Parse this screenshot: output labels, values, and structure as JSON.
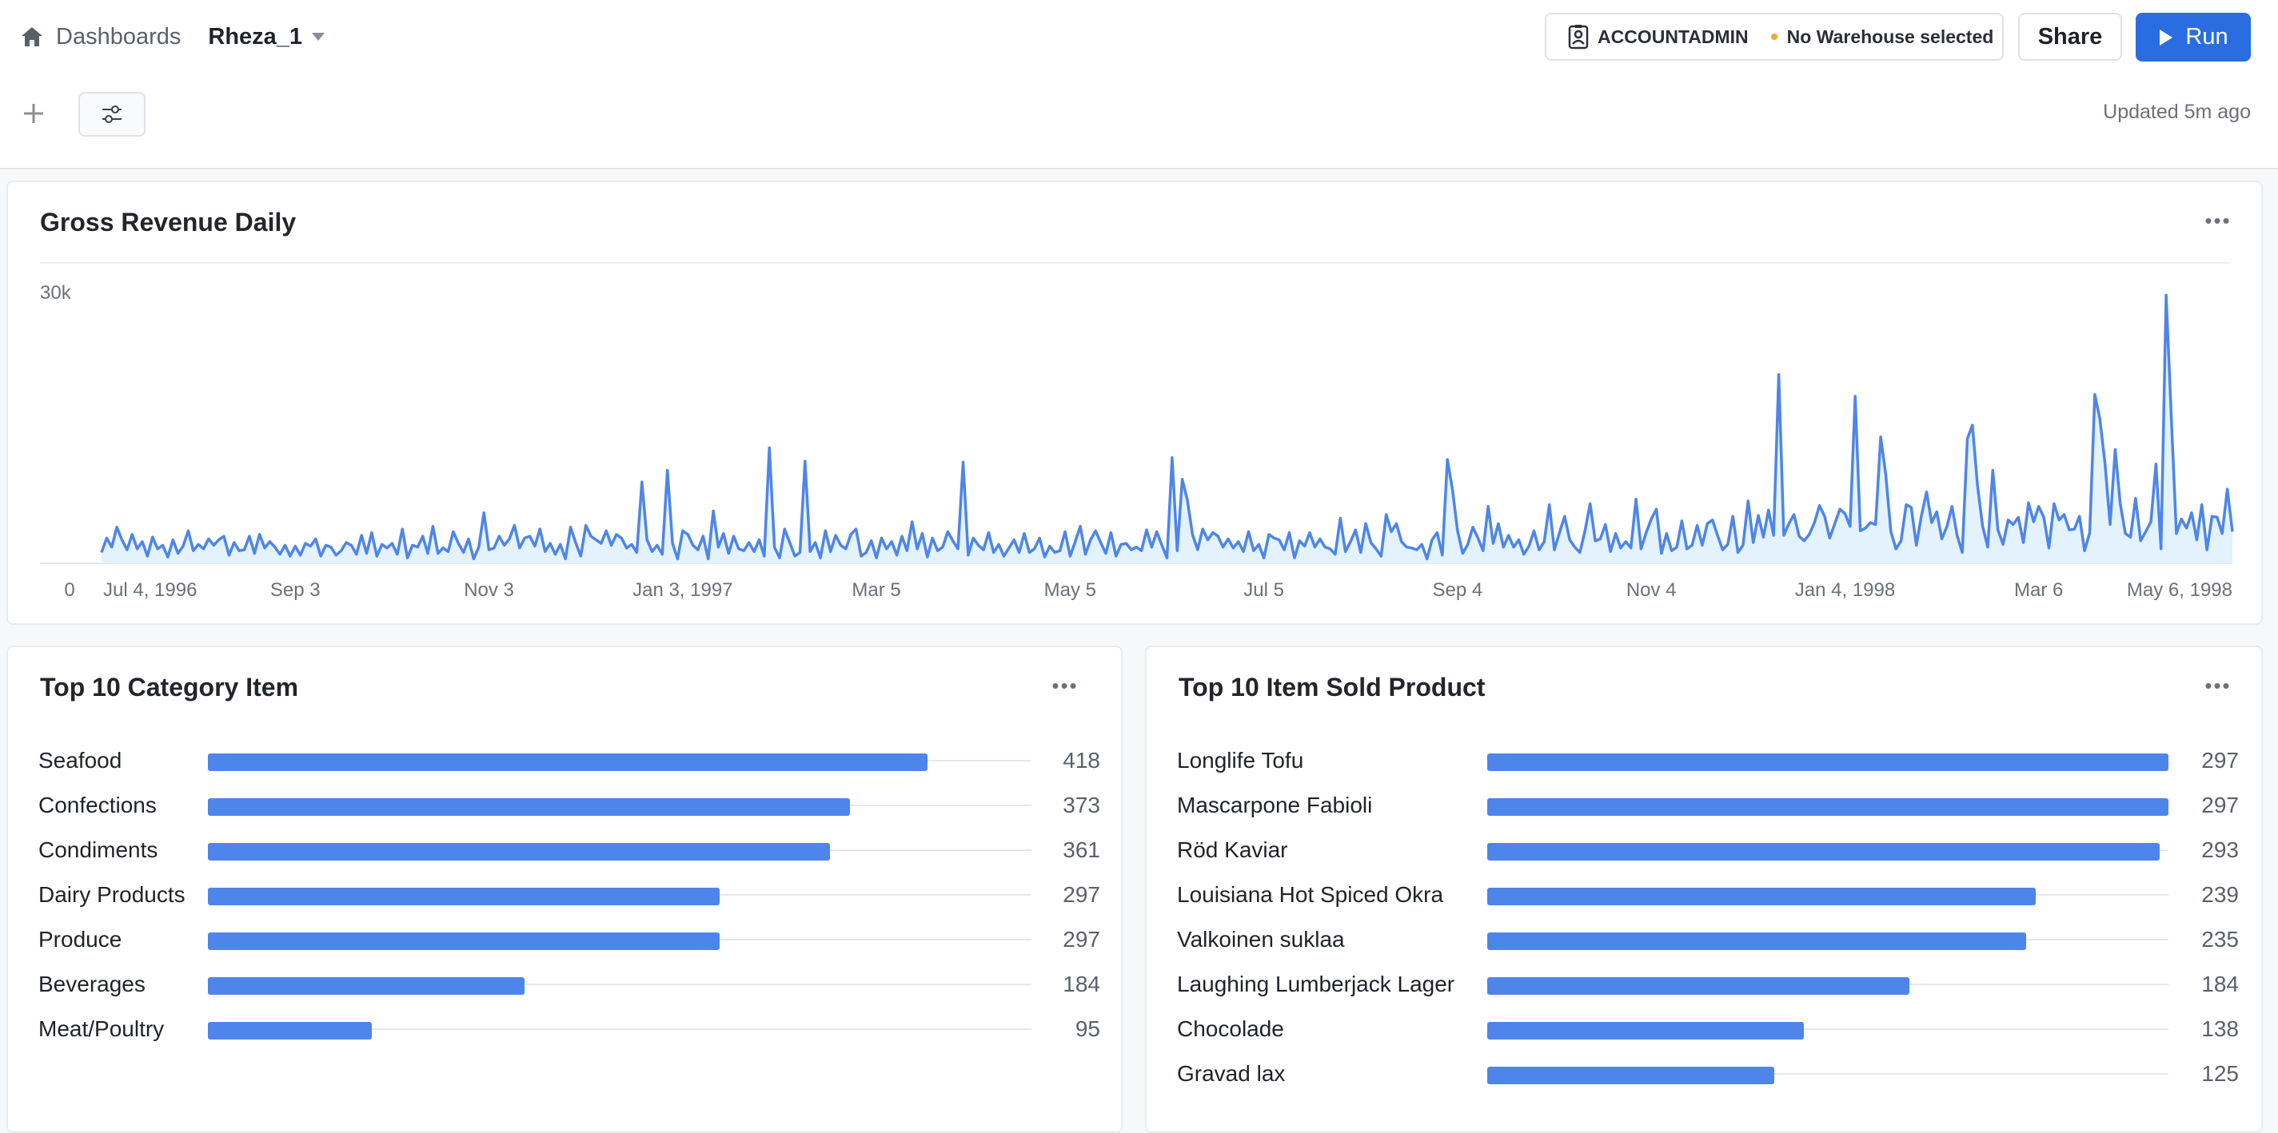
{
  "header": {
    "home_icon": "home-icon",
    "breadcrumb_label": "Dashboards",
    "dashboard_name": "Rheza_1",
    "role": "ACCOUNTADMIN",
    "warehouse": "No Warehouse selected",
    "share_label": "Share",
    "run_label": "Run",
    "updated_text": "Updated 5m ago",
    "colors": {
      "run_button": "#2a6de0",
      "warehouse_dot": "#f0a92c"
    }
  },
  "revenue_card": {
    "title": "Gross Revenue Daily",
    "more_icon": "more-horizontal-icon"
  },
  "category_card": {
    "title": "Top 10 Category Item",
    "more_icon": "more-horizontal-icon"
  },
  "product_card": {
    "title": "Top 10 Item Sold Product",
    "more_icon": "more-horizontal-icon"
  },
  "chart_data": [
    {
      "type": "area",
      "title": "Gross Revenue Daily",
      "xlabel": "",
      "ylabel": "",
      "ylim": [
        0,
        30000
      ],
      "y_ticks": [
        "0",
        "30k"
      ],
      "x_ticks": [
        "Jul 4, 1996",
        "Sep 3",
        "Nov 3",
        "Jan 3, 1997",
        "Mar 5",
        "May 5",
        "Jul 5",
        "Sep 4",
        "Nov 4",
        "Jan 4, 1998",
        "Mar 6",
        "May 6, 1998"
      ],
      "x_range": [
        "1996-07-04",
        "1998-05-06"
      ],
      "color": "#4e85ea",
      "fill": "#e3f2fc",
      "series": [
        {
          "values": [
            1200,
            2800,
            1800,
            4000,
            2600,
            1500,
            3200,
            1600,
            2400,
            800,
            2900,
            1600,
            2000,
            700,
            2600,
            1100,
            1900,
            3600,
            1400,
            2100,
            1600,
            2700,
            2000,
            2600,
            3000,
            900,
            2300,
            1400,
            1500,
            3000,
            1100,
            3200,
            1700,
            2400,
            1800,
            1000,
            2000,
            800,
            1900,
            900,
            2200,
            1900,
            2700,
            800,
            2000,
            1800,
            900,
            1400,
            2300,
            2000,
            1000,
            3100,
            1100,
            3400,
            800,
            2100,
            1700,
            2200,
            1000,
            3800,
            600,
            2000,
            1800,
            3000,
            1100,
            4100,
            1100,
            1700,
            1300,
            3500,
            2200,
            1200,
            2700,
            500,
            1800,
            5600,
            1500,
            1700,
            3000,
            2000,
            2700,
            4200,
            1700,
            2800,
            3000,
            1900,
            3800,
            1300,
            2200,
            1000,
            2100,
            500,
            4000,
            2300,
            800,
            4200,
            3000,
            2600,
            2200,
            3600,
            2000,
            3200,
            2800,
            1700,
            2100,
            1200,
            9000,
            2600,
            1300,
            2000,
            1000,
            10300,
            2200,
            500,
            3600,
            3200,
            2000,
            1500,
            3000,
            500,
            5800,
            1800,
            3300,
            1100,
            3000,
            1600,
            1400,
            2300,
            1300,
            2600,
            800,
            12800,
            1800,
            600,
            3800,
            2300,
            800,
            1200,
            11300,
            1300,
            2300,
            600,
            3600,
            1300,
            3100,
            2000,
            1600,
            3200,
            3800,
            800,
            1200,
            2500,
            600,
            2800,
            1600,
            2400,
            900,
            3000,
            1400,
            4600,
            1600,
            3300,
            700,
            2800,
            1400,
            1800,
            3500,
            2500,
            1600,
            11200,
            900,
            2800,
            2000,
            1500,
            3400,
            1200,
            2100,
            800,
            1700,
            2600,
            1200,
            3300,
            1200,
            1600,
            2800,
            700,
            1900,
            1200,
            1400,
            3500,
            800,
            2400,
            4100,
            1000,
            2600,
            3600,
            2300,
            1100,
            3400,
            800,
            2100,
            2200,
            1500,
            1800,
            1400,
            3700,
            1800,
            3500,
            2000,
            600,
            11700,
            1400,
            9300,
            7000,
            3200,
            1500,
            3800,
            2600,
            3400,
            3000,
            1800,
            2700,
            1700,
            2400,
            1300,
            3500,
            1400,
            2100,
            600,
            3200,
            2800,
            2600,
            1500,
            3400,
            600,
            2500,
            1900,
            3400,
            1800,
            2700,
            1800,
            1600,
            1000,
            5000,
            1300,
            2400,
            3700,
            1200,
            4400,
            2300,
            1600,
            800,
            5400,
            3500,
            4400,
            2400,
            1800,
            1700,
            1500,
            2100,
            500,
            2600,
            3400,
            900,
            11500,
            8200,
            3600,
            1100,
            2100,
            4000,
            2800,
            1400,
            6300,
            2200,
            4400,
            1800,
            3100,
            1800,
            2600,
            1000,
            1900,
            3600,
            1500,
            2400,
            6500,
            1500,
            3400,
            5200,
            2600,
            1800,
            1200,
            3600,
            6600,
            2500,
            2700,
            4300,
            1300,
            3300,
            1700,
            2400,
            1700,
            7100,
            1600,
            3400,
            4900,
            6000,
            1100,
            3300,
            1400,
            1800,
            4700,
            1600,
            2000,
            4200,
            2000,
            4400,
            4800,
            3100,
            1500,
            2100,
            5200,
            1200,
            2000,
            6900,
            2300,
            5300,
            2900,
            5900,
            3100,
            20900,
            3100,
            4400,
            5400,
            3000,
            2500,
            3200,
            4500,
            6400,
            5200,
            2800,
            4400,
            6000,
            5500,
            4100,
            18500,
            3600,
            3900,
            4500,
            4300,
            14000,
            9800,
            3500,
            1600,
            2500,
            6500,
            6200,
            2000,
            5300,
            7900,
            4500,
            5700,
            2700,
            4100,
            6300,
            3100,
            1200,
            13800,
            15300,
            8600,
            4100,
            1800,
            10300,
            3700,
            2100,
            4800,
            4300,
            5100,
            2300,
            6700,
            4600,
            6300,
            5100,
            1700,
            6600,
            4800,
            5400,
            3700,
            3800,
            5200,
            1400,
            3400,
            18700,
            16000,
            11100,
            4300,
            12600,
            6600,
            3300,
            2900,
            7200,
            2500,
            3500,
            4600,
            11000,
            1600,
            29700,
            16300,
            3300,
            4900,
            3900,
            5600,
            2600,
            6500,
            1500,
            5200,
            5100,
            3300,
            8200,
            3500
          ]
        }
      ]
    },
    {
      "type": "bar",
      "title": "Top 10 Category Item",
      "orientation": "horizontal",
      "categories": [
        "Seafood",
        "Confections",
        "Condiments",
        "Dairy Products",
        "Produce",
        "Beverages",
        "Meat/Poultry"
      ],
      "values": [
        418,
        373,
        361,
        297,
        297,
        184,
        95
      ],
      "value_labels": [
        "418",
        "373",
        "361",
        "297",
        "297",
        "184",
        "95"
      ],
      "xlim": [
        0,
        500
      ],
      "color": "#4e85ea"
    },
    {
      "type": "bar",
      "title": "Top 10 Item Sold Product",
      "orientation": "horizontal",
      "categories": [
        "Longlife Tofu",
        "Mascarpone Fabioli",
        "Röd Kaviar",
        "Louisiana Hot Spiced Okra",
        "Valkoinen suklaa",
        "Laughing Lumberjack Lager",
        "Chocolade",
        "Gravad lax"
      ],
      "values": [
        297,
        297,
        293,
        239,
        235,
        184,
        138,
        125
      ],
      "value_labels": [
        "297",
        "297",
        "293",
        "239",
        "235",
        "184",
        "138",
        "125"
      ],
      "xlim": [
        0,
        297
      ],
      "color": "#4e85ea"
    }
  ]
}
